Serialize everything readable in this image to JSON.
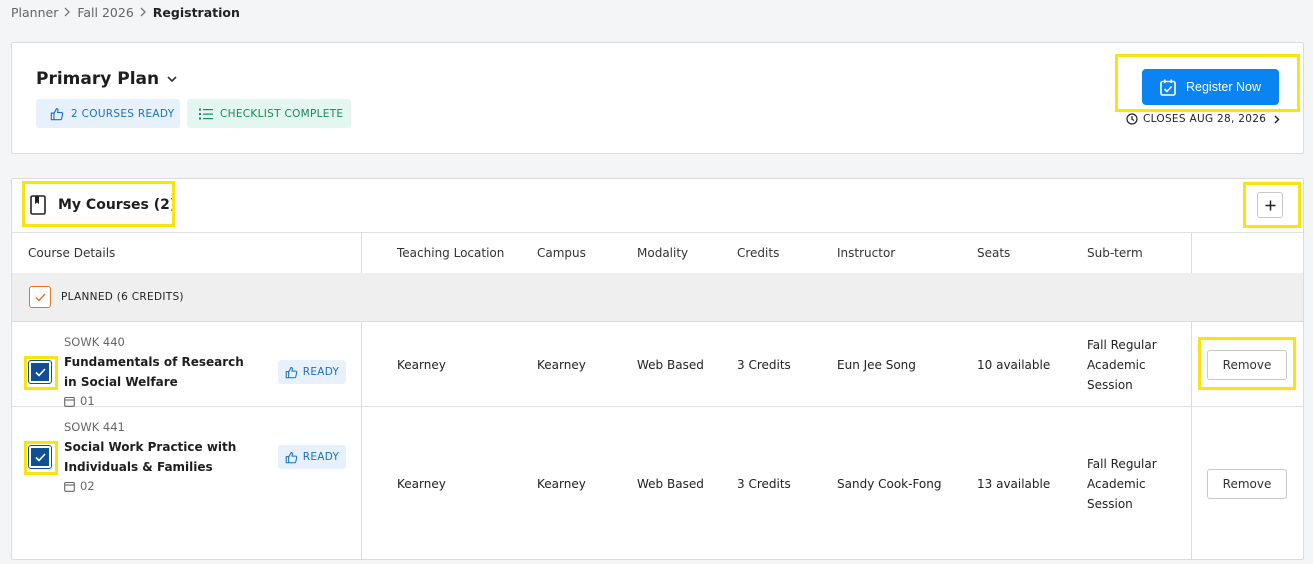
{
  "breadcrumb": {
    "items": [
      "Planner",
      "Fall 2026"
    ],
    "current": "Registration"
  },
  "plan": {
    "title": "Primary Plan",
    "badges": {
      "ready": "2 COURSES READY",
      "checklist": "CHECKLIST COMPLETE"
    },
    "register_label": "Register Now",
    "closes": "CLOSES AUG 28, 2026"
  },
  "courses": {
    "title": "My Courses (2)",
    "columns": [
      "Course Details",
      "Teaching Location",
      "Campus",
      "Modality",
      "Credits",
      "Instructor",
      "Seats",
      "Sub-term"
    ],
    "planned_label": "PLANNED (6 CREDITS)",
    "rows": [
      {
        "code": "SOWK 440",
        "title": "Fundamentals of Research in Social Welfare",
        "section": "01",
        "status": "READY",
        "teaching_location": "Kearney",
        "campus": "Kearney",
        "modality": "Web Based",
        "credits": "3 Credits",
        "instructor": "Eun Jee Song",
        "seats": "10 available",
        "subterm": [
          "Fall Regular",
          "Academic",
          "Session"
        ],
        "remove_label": "Remove"
      },
      {
        "code": "SOWK 441",
        "title": "Social Work Practice with Individuals & Families",
        "section": "02",
        "status": "READY",
        "teaching_location": "Kearney",
        "campus": "Kearney",
        "modality": "Web Based",
        "credits": "3 Credits",
        "instructor": "Sandy Cook-Fong",
        "seats": "13 available",
        "subterm": [
          "Fall Regular",
          "Academic",
          "Session"
        ],
        "remove_label": "Remove"
      }
    ]
  },
  "colors": {
    "accent": "#0a84f0",
    "highlight": "#f8e40e",
    "checkbox": "#0e4f96",
    "planned_check": "#e0762a"
  }
}
